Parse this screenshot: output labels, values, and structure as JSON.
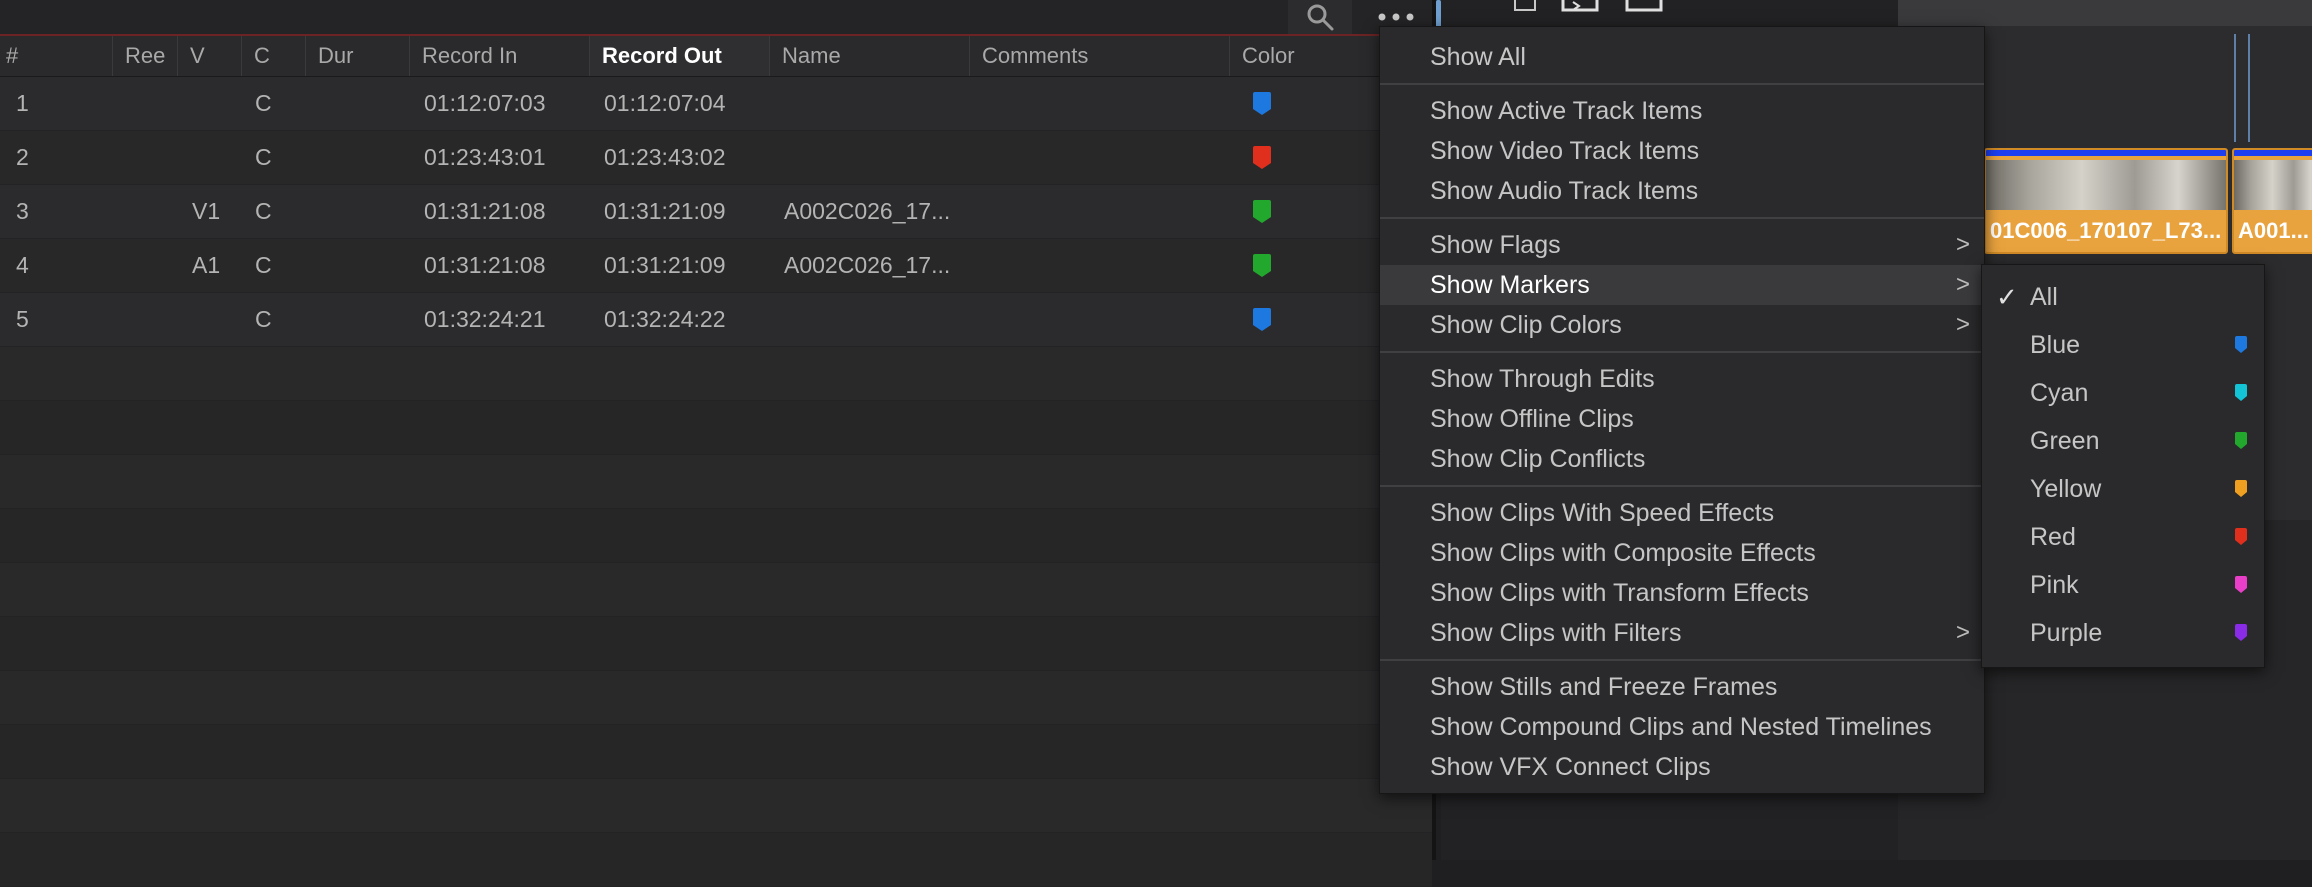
{
  "index": {
    "columns": [
      {
        "key": "num",
        "label": "#"
      },
      {
        "key": "reel",
        "label": "Ree"
      },
      {
        "key": "v",
        "label": "V"
      },
      {
        "key": "c",
        "label": "C"
      },
      {
        "key": "dur",
        "label": "Dur"
      },
      {
        "key": "rec_in",
        "label": "Record In"
      },
      {
        "key": "rec_out",
        "label": "Record Out"
      },
      {
        "key": "name",
        "label": "Name"
      },
      {
        "key": "comments",
        "label": "Comments"
      },
      {
        "key": "color",
        "label": "Color"
      }
    ],
    "rows": [
      {
        "num": "1",
        "v": "",
        "c": "C",
        "rec_in": "01:12:07:03",
        "rec_out": "01:12:07:04",
        "name": "",
        "color": "#1d78e0"
      },
      {
        "num": "2",
        "v": "",
        "c": "C",
        "rec_in": "01:23:43:01",
        "rec_out": "01:23:43:02",
        "name": "",
        "color": "#e0301d"
      },
      {
        "num": "3",
        "v": "V1",
        "c": "C",
        "rec_in": "01:31:21:08",
        "rec_out": "01:31:21:09",
        "name": "A002C026_17...",
        "color": "#22a82c"
      },
      {
        "num": "4",
        "v": "A1",
        "c": "C",
        "rec_in": "01:31:21:08",
        "rec_out": "01:31:21:09",
        "name": "A002C026_17...",
        "color": "#22a82c"
      },
      {
        "num": "5",
        "v": "",
        "c": "C",
        "rec_in": "01:32:24:21",
        "rec_out": "01:32:24:22",
        "name": "",
        "color": "#1d78e0"
      }
    ]
  },
  "timeline": {
    "clip1_label": "01C006_170107_L73...",
    "clip2_label": "A001..."
  },
  "menu": {
    "items": [
      {
        "label": "Show All"
      },
      {
        "label": "Show Active Track Items"
      },
      {
        "label": "Show Video Track Items"
      },
      {
        "label": "Show Audio Track Items"
      },
      {
        "label": "Show Flags",
        "submenu": true
      },
      {
        "label": "Show Markers",
        "submenu": true,
        "highlighted": true
      },
      {
        "label": "Show Clip Colors",
        "submenu": true
      },
      {
        "label": "Show Through Edits"
      },
      {
        "label": "Show Offline Clips"
      },
      {
        "label": "Show Clip Conflicts"
      },
      {
        "label": "Show Clips With Speed Effects"
      },
      {
        "label": "Show Clips with Composite Effects"
      },
      {
        "label": "Show Clips with Transform Effects"
      },
      {
        "label": "Show Clips with Filters",
        "submenu": true
      },
      {
        "label": "Show Stills and Freeze Frames"
      },
      {
        "label": "Show Compound Clips and Nested Timelines"
      },
      {
        "label": "Show VFX Connect Clips"
      }
    ],
    "chevron": ">"
  },
  "submenu": {
    "check": "✓",
    "items": [
      {
        "label": "All",
        "checked": true
      },
      {
        "label": "Blue",
        "color": "#1d78e0"
      },
      {
        "label": "Cyan",
        "color": "#12c4d6"
      },
      {
        "label": "Green",
        "color": "#22a82c"
      },
      {
        "label": "Yellow",
        "color": "#f0a020"
      },
      {
        "label": "Red",
        "color": "#e0301d"
      },
      {
        "label": "Pink",
        "color": "#e83ec8"
      },
      {
        "label": "Purple",
        "color": "#8a2be8"
      }
    ]
  }
}
